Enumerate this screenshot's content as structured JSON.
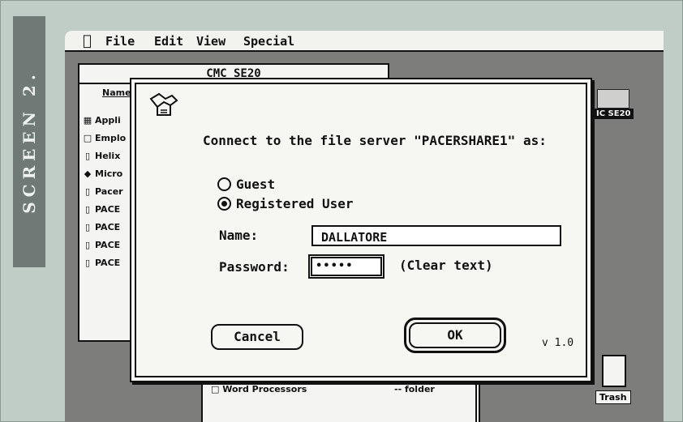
{
  "side_label": "SCREEN 2.",
  "menubar": {
    "items": [
      "File",
      "Edit",
      "View",
      "Special"
    ]
  },
  "back_window": {
    "title": "CMC SE20",
    "column_header": "Name",
    "rows": [
      "Appli",
      "Emplo",
      "Helix",
      "Micro",
      "Pacer",
      "PACE",
      "PACE",
      "PACE",
      "PACE"
    ]
  },
  "desktop_icon": {
    "label": "IC SE20"
  },
  "bottom_window": {
    "row_name": "Word Processors",
    "row_kind": "-- folder"
  },
  "trash": {
    "label": "Trash"
  },
  "version_text": "v 1.0",
  "dialog": {
    "prompt": "Connect to the file server \"PACERSHARE1\" as:",
    "options": {
      "guest": "Guest",
      "registered": "Registered User",
      "selected": "registered"
    },
    "name_label": "Name:",
    "name_value": "DALLATORE",
    "password_label": "Password:",
    "password_value": "•••••",
    "clear_text_label": "(Clear text)",
    "cancel_label": "Cancel",
    "ok_label": "OK"
  }
}
